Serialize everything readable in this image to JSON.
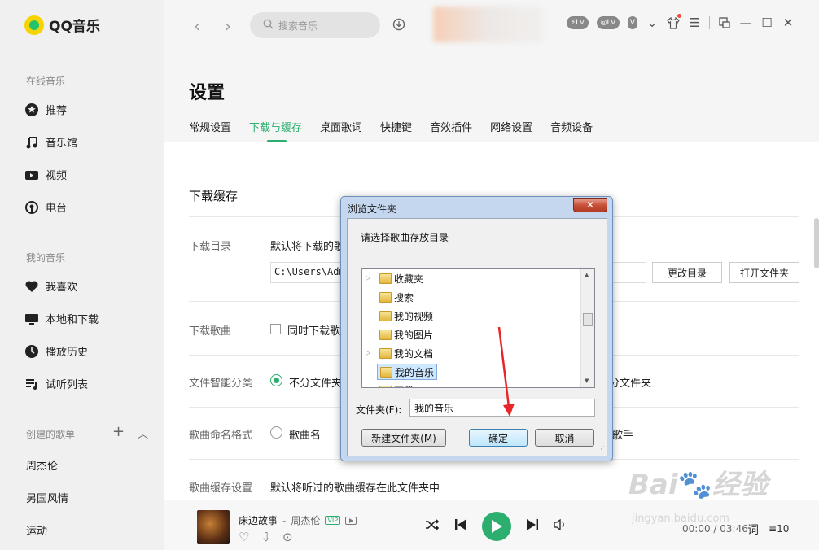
{
  "app": {
    "name": "QQ音乐"
  },
  "sidebar": {
    "online_title": "在线音乐",
    "online_items": [
      {
        "label": "推荐",
        "icon": "star-icon"
      },
      {
        "label": "音乐馆",
        "icon": "music-note-icon"
      },
      {
        "label": "视频",
        "icon": "video-icon"
      },
      {
        "label": "电台",
        "icon": "radio-icon"
      }
    ],
    "my_title": "我的音乐",
    "my_items": [
      {
        "label": "我喜欢",
        "icon": "heart-icon"
      },
      {
        "label": "本地和下载",
        "icon": "monitor-icon"
      },
      {
        "label": "播放历史",
        "icon": "history-icon"
      },
      {
        "label": "试听列表",
        "icon": "playlist-icon"
      }
    ],
    "created_title": "创建的歌单",
    "playlists": [
      "周杰伦",
      "另国风情",
      "运动"
    ]
  },
  "topbar": {
    "search_placeholder": "搜索音乐"
  },
  "settings": {
    "title": "设置",
    "tabs": [
      "常规设置",
      "下载与缓存",
      "桌面歌词",
      "快捷键",
      "音效插件",
      "网络设置",
      "音频设备"
    ],
    "active_tab": 1,
    "section_title": "下载缓存",
    "download_dir_label": "下载目录",
    "download_dir_desc": "默认将下载的歌",
    "download_path": "C:\\Users\\Admi",
    "change_dir_button": "更改目录",
    "open_folder_button": "打开文件夹",
    "download_song_label": "下载歌曲",
    "download_song_option": "同时下载歌",
    "smart_sort_label": "文件智能分类",
    "smart_sort_option1": "不分文件夹",
    "smart_sort_option2": "分文件夹",
    "naming_label": "歌曲命名格式",
    "naming_option1": "歌曲名",
    "naming_option2": "歌手",
    "cache_label": "歌曲缓存设置",
    "cache_desc": "默认将听过的歌曲缓存在此文件夹中"
  },
  "player": {
    "song": "床边故事",
    "artist": "周杰伦",
    "vip": "VIP",
    "time": "00:00 / 03:46",
    "lyric": "词",
    "queue_count": "10"
  },
  "dialog": {
    "title": "浏览文件夹",
    "close": "✕",
    "prompt": "请选择歌曲存放目录",
    "tree": [
      "收藏夹",
      "搜索",
      "我的视频",
      "我的图片",
      "我的文档",
      "我的音乐",
      "下载"
    ],
    "selected": 5,
    "folder_label": "文件夹(F):",
    "folder_value": "我的音乐",
    "new_folder": "新建文件夹(M)",
    "ok": "确定",
    "cancel": "取消"
  },
  "watermark": {
    "main": "Bai 经验",
    "sub": "jingyan.baidu.com"
  },
  "colors": {
    "accent": "#2caf6e",
    "sidebar": "#f0f0f0",
    "dialog_frame": "#c4d7ee"
  }
}
